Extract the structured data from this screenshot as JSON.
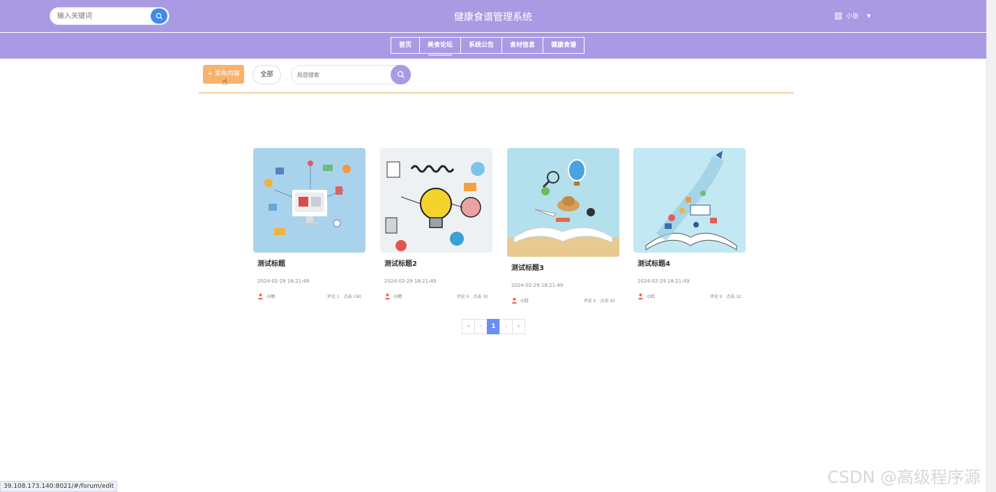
{
  "header": {
    "search_placeholder": "输入关键词",
    "site_title": "健康食谱管理系统",
    "username": "小张"
  },
  "nav": {
    "items": [
      {
        "label": "首页"
      },
      {
        "label": "美食论坛"
      },
      {
        "label": "系统公告"
      },
      {
        "label": "食材信息"
      },
      {
        "label": "健康食谱"
      }
    ],
    "active": "美食论坛"
  },
  "toolbar": {
    "publish_label": "+ 发布内容",
    "all_label": "全部",
    "local_search_placeholder": "局部搜索"
  },
  "posts": [
    {
      "title": "测试标题",
      "time": "2024-02-29 18:21:49",
      "author": "小明",
      "comments": "评论 1",
      "clicks": "点击 190",
      "image": "monitor-icons-illustration"
    },
    {
      "title": "测试标题2",
      "time": "2024-02-29 18:21:49",
      "author": "小明",
      "comments": "评论 0",
      "clicks": "点击 30",
      "image": "learn-lightbulb-illustration"
    },
    {
      "title": "测试标题3",
      "time": "2024-02-29 18:21:49",
      "author": "小红",
      "comments": "评论 0",
      "clicks": "点击 42",
      "image": "open-book-travel-illustration"
    },
    {
      "title": "测试标题4",
      "time": "2024-02-29 18:21:49",
      "author": "小红",
      "comments": "评论 0",
      "clicks": "点击 32",
      "image": "open-book-rocket-illustration"
    }
  ],
  "pagination": {
    "first": "«",
    "prev": "‹",
    "current": "1",
    "next": "›",
    "last": "»"
  },
  "status_bar": {
    "url": "39.108.173.140:8021/#/forum/edit"
  },
  "watermark": "CSDN @高级程序源",
  "colors": {
    "header_bg": "#a99ae3",
    "publish_btn": "#f7b36b",
    "search_btn": "#3b8cf0",
    "page_active": "#6b8ef5",
    "divider": "#f5cfa0"
  }
}
